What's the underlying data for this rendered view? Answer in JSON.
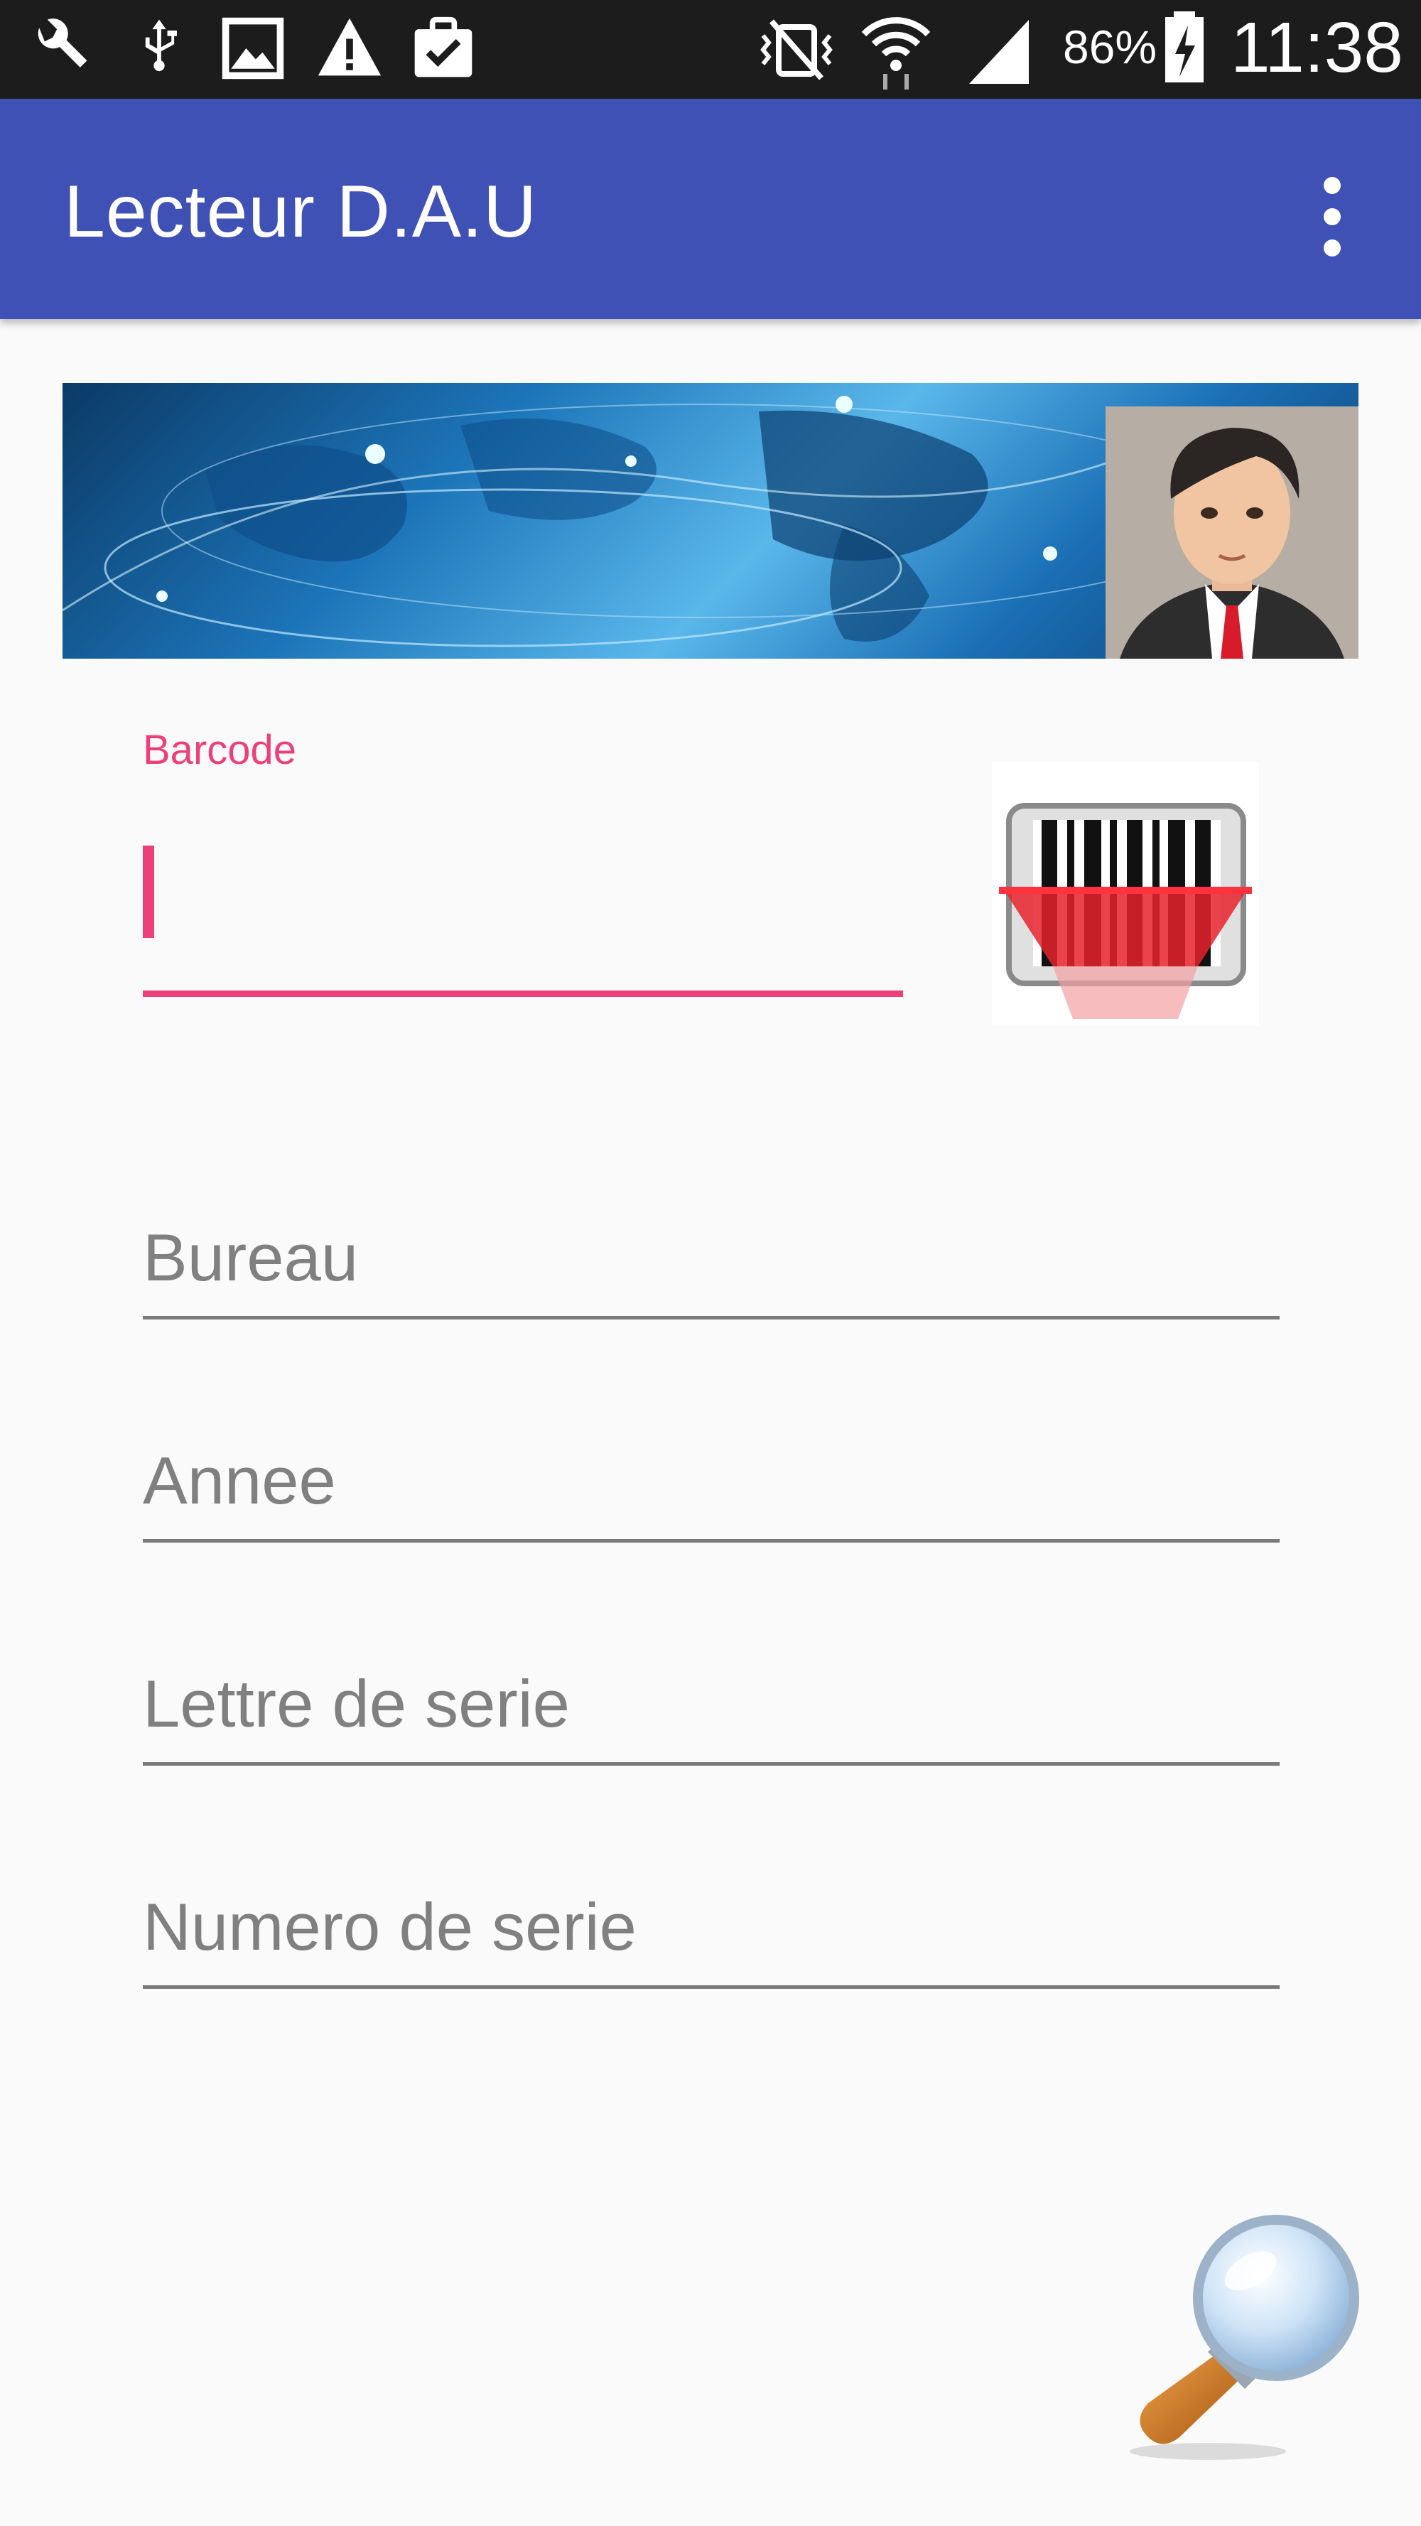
{
  "status_bar": {
    "battery": "86%",
    "time": "11:38",
    "icons": [
      "wrench-icon",
      "usb-icon",
      "image-icon",
      "warning-icon",
      "clipboard-check-icon",
      "vibrate-icon",
      "wifi-icon",
      "signal-icon",
      "battery-charging-icon"
    ]
  },
  "app_bar": {
    "title": "Lecteur D.A.U",
    "menu_icon": "more-vert-icon"
  },
  "form": {
    "barcode_label": "Barcode",
    "barcode_value": "",
    "bureau_placeholder": "Bureau",
    "annee_placeholder": "Annee",
    "lettre_placeholder": "Lettre de serie",
    "numero_placeholder": "Numero de serie"
  },
  "colors": {
    "primary": "#3f51b5",
    "accent": "#ec407a",
    "status_bar": "#1c1c1c",
    "background": "#fafafa"
  }
}
